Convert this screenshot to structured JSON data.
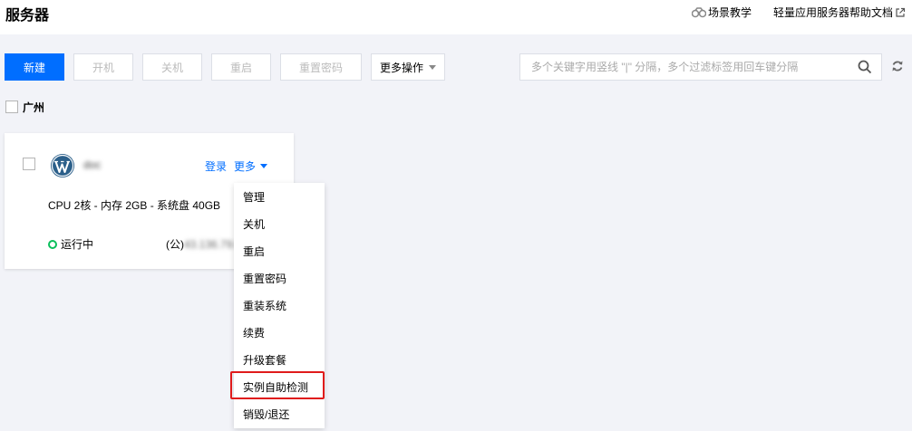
{
  "header": {
    "title": "服务器",
    "links": [
      {
        "label": "场景教学",
        "icon": "binoculars-icon"
      },
      {
        "label": "轻量应用服务器帮助文档",
        "icon": "external-link-icon"
      }
    ]
  },
  "toolbar": {
    "buttons": [
      {
        "label": "新建",
        "state": "primary"
      },
      {
        "label": "开机",
        "state": "disabled"
      },
      {
        "label": "关机",
        "state": "disabled"
      },
      {
        "label": "重启",
        "state": "disabled"
      },
      {
        "label": "重置密码",
        "state": "disabled"
      },
      {
        "label": "更多操作",
        "state": "dropdown"
      }
    ],
    "search_placeholder": "多个关键字用竖线 \"|\" 分隔，多个过滤标签用回车键分隔",
    "search_value": ""
  },
  "region": {
    "label": "广州"
  },
  "instance": {
    "name": "doc",
    "image_icon": "wordpress-icon",
    "login_label": "登录",
    "more_label": "更多",
    "specs": "CPU 2核 - 内存 2GB - 系统盘 40GB",
    "status": "运行中",
    "ip_prefix": "(公)",
    "ip_value": "43.136.79.6",
    "status_color": "#0abf5b"
  },
  "more_menu": {
    "items": [
      "管理",
      "关机",
      "重启",
      "重置密码",
      "重装系统",
      "续费",
      "升级套餐",
      "实例自助检测",
      "销毁/退还"
    ],
    "highlighted_item": "实例自助检测",
    "highlight_color": "#e01b1b"
  },
  "colors": {
    "primary": "#006eff",
    "background": "#f2f3f8"
  }
}
